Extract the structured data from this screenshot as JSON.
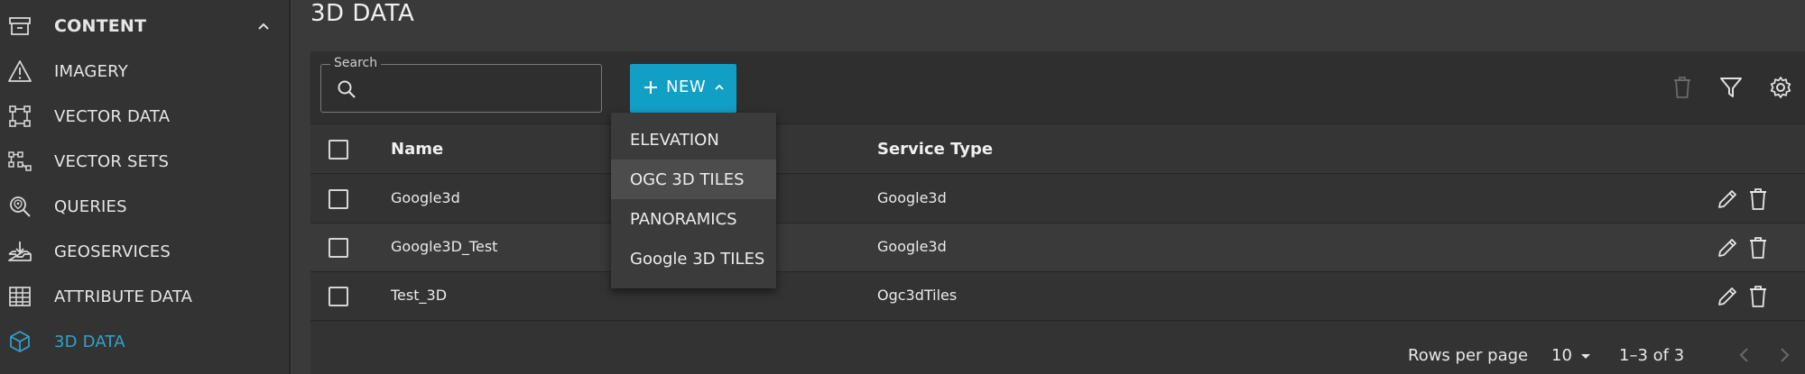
{
  "sidebar": {
    "header": {
      "label": "CONTENT",
      "icon": "archive-icon"
    },
    "items": [
      {
        "label": "IMAGERY",
        "icon": "warning-triangle-icon"
      },
      {
        "label": "VECTOR DATA",
        "icon": "vector-square-icon"
      },
      {
        "label": "VECTOR SETS",
        "icon": "vector-sets-icon"
      },
      {
        "label": "QUERIES",
        "icon": "location-search-icon"
      },
      {
        "label": "GEOSERVICES",
        "icon": "tray-download-icon"
      },
      {
        "label": "ATTRIBUTE DATA",
        "icon": "table-grid-icon"
      },
      {
        "label": "3D DATA",
        "icon": "cube-icon",
        "active": true
      }
    ]
  },
  "page": {
    "title": "3D DATA"
  },
  "toolbar": {
    "search_label": "Search",
    "search_value": "",
    "new_label": "NEW"
  },
  "table": {
    "columns": [
      "Name",
      "Service Type"
    ],
    "rows": [
      {
        "name": "Google3d",
        "service_type": "Google3d"
      },
      {
        "name": "Google3D_Test",
        "service_type": "Google3d"
      },
      {
        "name": "Test_3D",
        "service_type": "Ogc3dTiles"
      }
    ]
  },
  "pagination": {
    "rows_per_page_label": "Rows per page",
    "rows_per_page_value": "10",
    "range": "1–3 of 3"
  },
  "new_menu": {
    "items": [
      "ELEVATION",
      "OGC 3D TILES",
      "PANORAMICS",
      "Google 3D TILES"
    ],
    "highlighted": "OGC 3D TILES"
  },
  "colors": {
    "accent": "#119fc6",
    "active_text": "#2fa3c9",
    "background": "#3a3a3a"
  }
}
